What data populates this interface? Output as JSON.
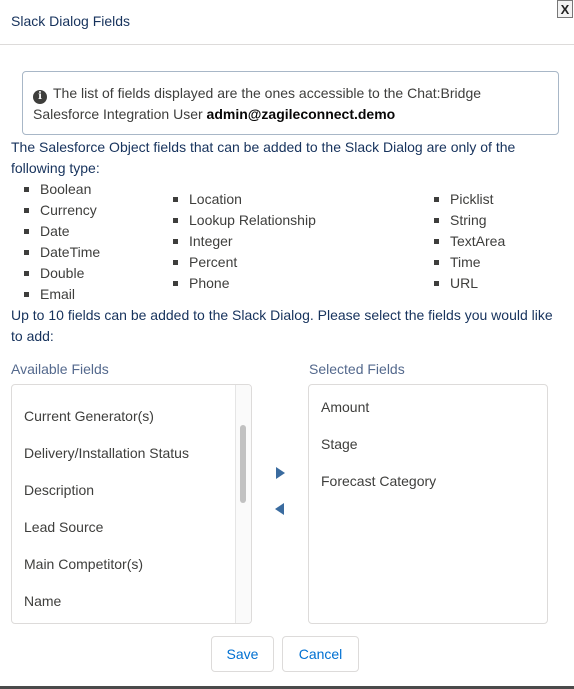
{
  "dialog": {
    "title": "Slack Dialog Fields",
    "close_label": "X"
  },
  "info": {
    "icon": "info-icon",
    "text": "The list of fields displayed are the ones accessible to the Chat:Bridge Salesforce Integration User",
    "user": "admin@zagileconnect.demo"
  },
  "description": "The Salesforce Object fields that can be added to the Slack Dialog are only of the following type:",
  "types": {
    "col1": [
      "Boolean",
      "Currency",
      "Date",
      "DateTime",
      "Double",
      "Email"
    ],
    "col2": [
      "Location",
      "Lookup Relationship",
      "Integer",
      "Percent",
      "Phone"
    ],
    "col3": [
      "Picklist",
      "String",
      "TextArea",
      "Time",
      "URL"
    ]
  },
  "limit_text": "Up to 10 fields can be added to the Slack Dialog. Please select the fields you would like to add:",
  "available": {
    "label": "Available Fields",
    "items": [
      "Current Generator(s)",
      "Delivery/Installation Status",
      "Description",
      "Lead Source",
      "Main Competitor(s)",
      "Name"
    ]
  },
  "selected": {
    "label": "Selected Fields",
    "items": [
      "Amount",
      "Stage",
      "Forecast Category"
    ]
  },
  "buttons": {
    "save": "Save",
    "cancel": "Cancel"
  },
  "colors": {
    "brand": "#0070d2",
    "heading": "#16325c",
    "arrow": "#3a6b9f"
  }
}
